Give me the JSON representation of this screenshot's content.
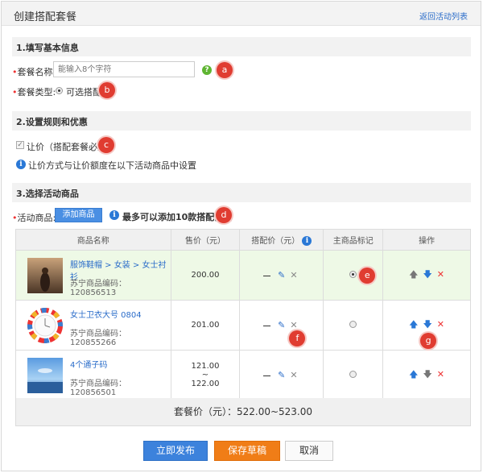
{
  "header": {
    "title": "创建搭配套餐",
    "back_link": "返回活动列表"
  },
  "section1": {
    "title": "1.填写基本信息",
    "name_label": "套餐名称:",
    "name_placeholder": "能输入8个字符",
    "type_label": "套餐类型:",
    "type_value": "可选搭配"
  },
  "section2": {
    "title": "2.设置规则和优惠",
    "checkbox_label": "让价（搭配套餐必选）",
    "info_text": "让价方式与让价额度在以下活动商品中设置"
  },
  "section3": {
    "title": "3.选择活动商品",
    "activity_label": "活动商品:",
    "add_button": "添加商品",
    "limit_text": "最多可以添加10款搭配商品"
  },
  "markers": [
    "a",
    "b",
    "c",
    "d",
    "e",
    "f",
    "g"
  ],
  "table": {
    "headers": [
      "商品名称",
      "售价（元）",
      "搭配价（元）",
      "主商品标记",
      "操作"
    ],
    "rows": [
      {
        "name": "服饰鞋帽 > 女装 > 女士衬衫",
        "code": "苏宁商品编码：120856513",
        "price": "200.00",
        "main": true
      },
      {
        "name": "女士卫衣大号 0804",
        "code": "苏宁商品编码：120855266",
        "price": "201.00",
        "main": false
      },
      {
        "name": "4个通子码",
        "code": "苏宁商品编码：120856501",
        "price_low": "121.00",
        "price_sep": "~",
        "price_high": "122.00",
        "main": false
      }
    ]
  },
  "total": "套餐价（元）：522.00~523.00",
  "buttons": {
    "publish": "立即发布",
    "draft": "保存草稿",
    "cancel": "取消"
  },
  "colors": {
    "accent_blue": "#3c82dc",
    "accent_orange": "#f07d17",
    "marker_red": "#e03c31",
    "link_blue": "#2a6cc9"
  },
  "icons": [
    "help-icon",
    "info-icon",
    "pencil-icon",
    "delete-icon",
    "arrow-up-icon",
    "arrow-down-icon"
  ]
}
